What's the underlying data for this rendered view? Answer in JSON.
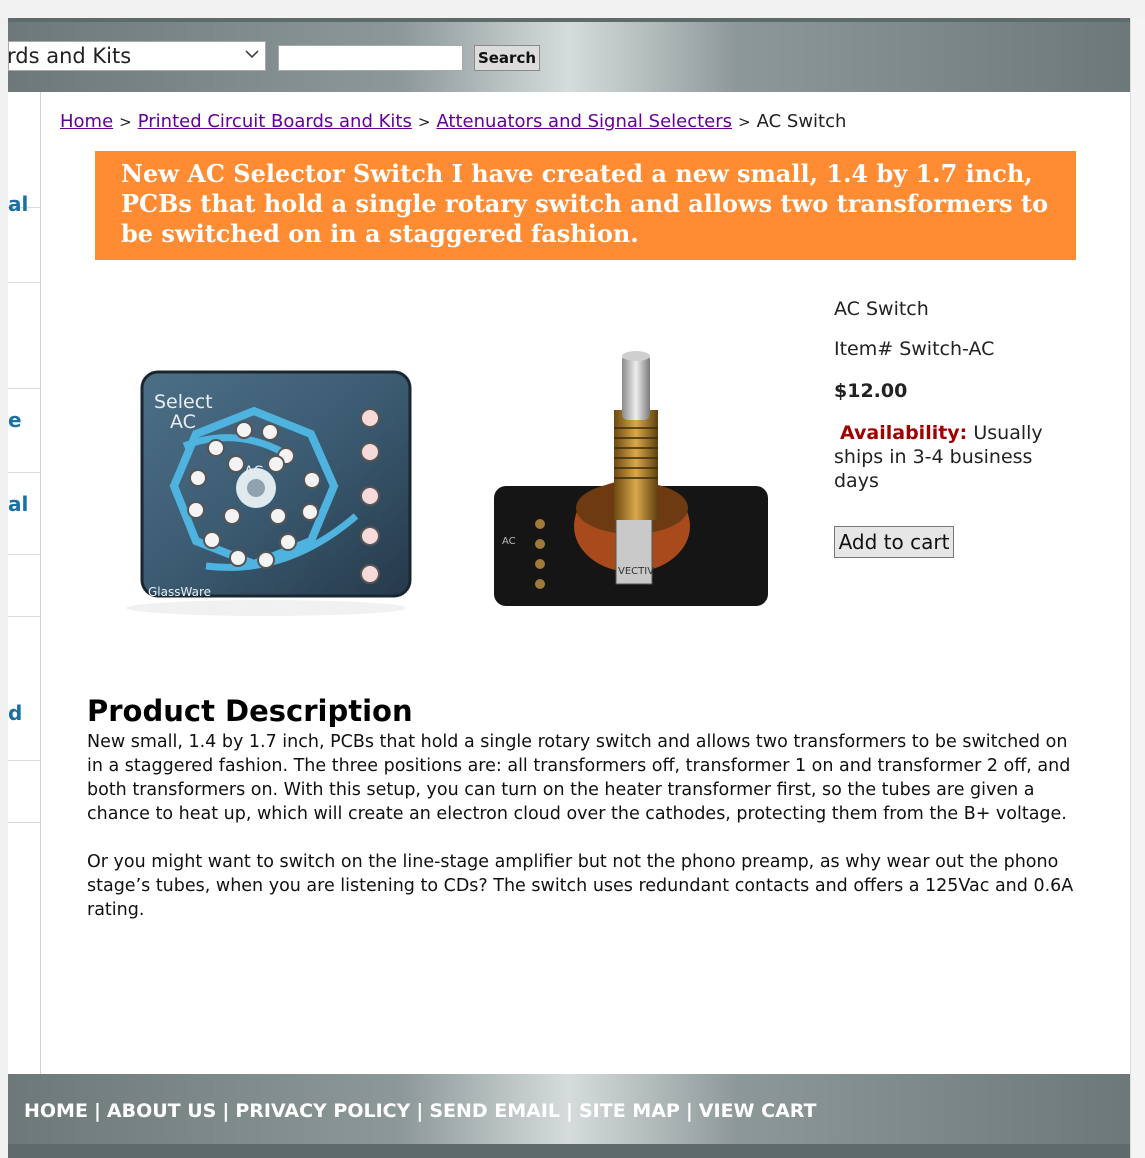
{
  "header": {
    "category_select": "rds and Kits",
    "search_value": "",
    "search_button": "Search"
  },
  "sidebar": {
    "items": [
      {
        "label": "al"
      },
      {
        "label": ""
      },
      {
        "label": "e"
      },
      {
        "label": "al"
      },
      {
        "label": ""
      },
      {
        "label": ""
      },
      {
        "label": "d"
      },
      {
        "label": ""
      }
    ]
  },
  "breadcrumb": {
    "home": "Home",
    "pcb": "Printed Circuit Boards and Kits",
    "attenuators": "Attenuators and Signal Selecters",
    "current": "AC Switch",
    "separator": ">"
  },
  "promo": {
    "text": "New AC Selector Switch I have created a new small, 1.4 by 1.7 inch, PCBs that hold a single rotary switch and allows two transformers to be switched on in a staggered fashion."
  },
  "images": {
    "pcb_labels": {
      "select": "Select",
      "ac": "AC",
      "ac_center": "AC",
      "glassware": "GlassWare"
    },
    "switch_labels": {
      "ac": "AC",
      "maker": "VECTIV"
    }
  },
  "product": {
    "name": "AC Switch",
    "item": "Item# Switch-AC",
    "price": "$12.00",
    "availability_label": "Availability:",
    "availability_text": "Usually ships in 3-4 business days",
    "add_to_cart": "Add to cart"
  },
  "description": {
    "title": "Product Description",
    "para1": "New small, 1.4 by 1.7 inch, PCBs that hold a single rotary switch and allows two transformers to be switched on in a staggered fashion. The three positions are: all transformers off, transformer 1 on and transformer 2 off, and both transformers on. With this setup, you can turn on the heater transformer first, so the tubes are given a chance to heat up, which will create an electron cloud over the cathodes, protecting them from the B+ voltage.",
    "para2": "Or you might want to switch on the line-stage amplifier but not the phono preamp, as why wear out the phono stage’s tubes, when you are listening to CDs? The switch uses redundant contacts and offers a 125Vac and 0.6A rating."
  },
  "footer": {
    "home": "HOME",
    "about": "ABOUT US",
    "privacy": "PRIVACY POLICY",
    "email": "SEND EMAIL",
    "sitemap": "SITE MAP",
    "cart": "VIEW CART",
    "separator": "|"
  },
  "colors": {
    "promo_bg": "#ff8c33",
    "link_visited": "#660099",
    "sidebar_link": "#1a6fa3",
    "availability": "#a00000"
  }
}
